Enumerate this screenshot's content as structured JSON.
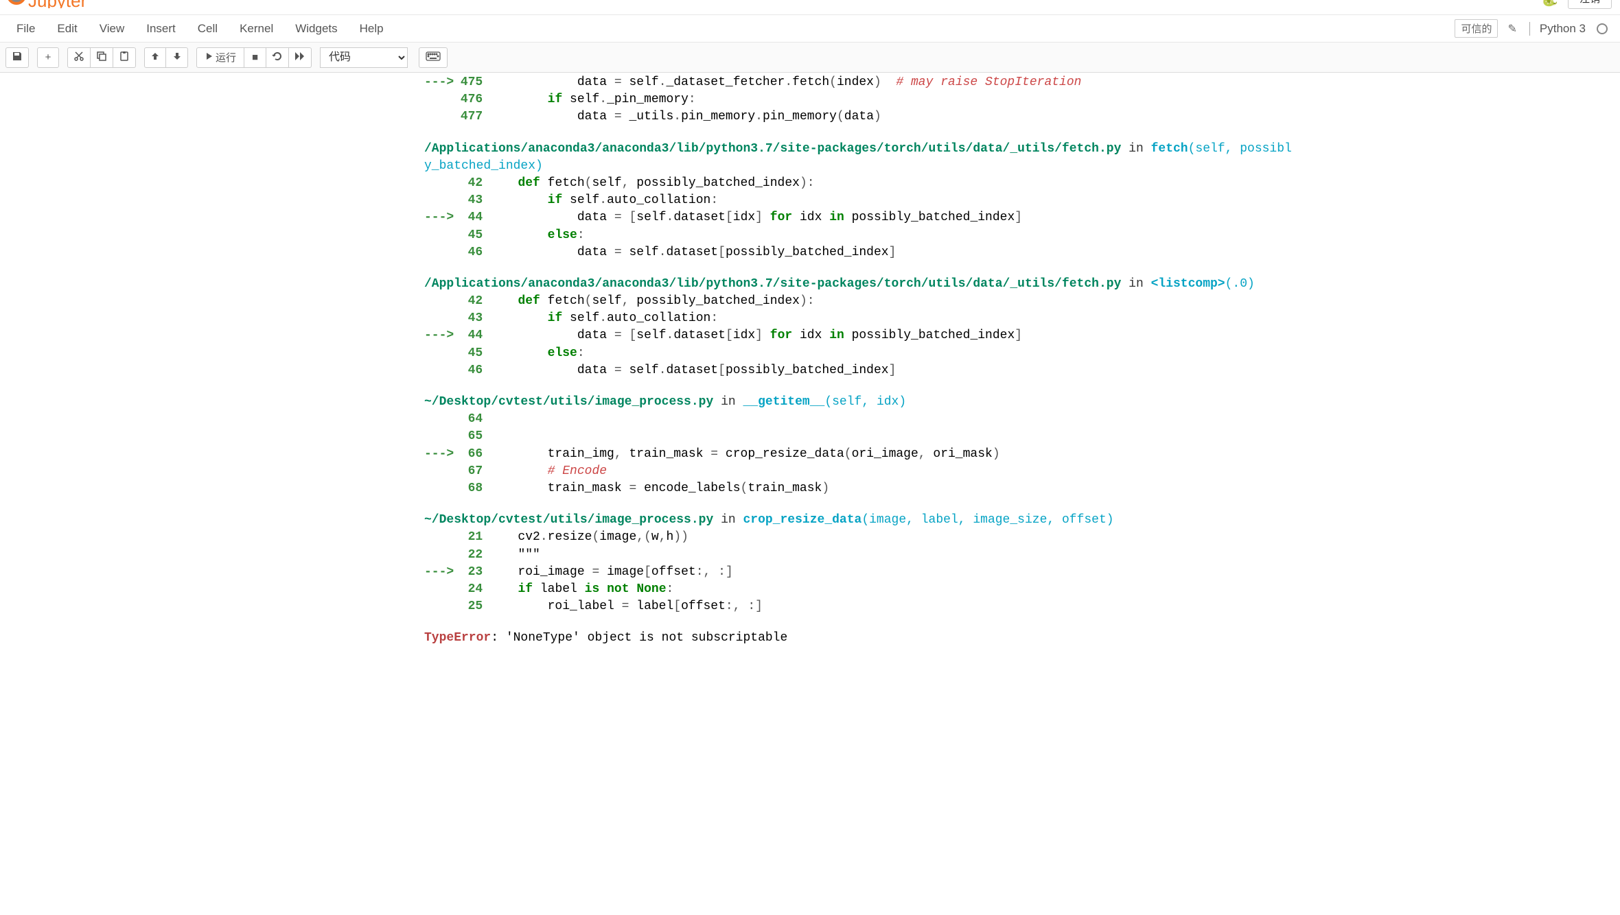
{
  "header": {
    "brand": "Jupyter",
    "logout": "注销",
    "trusted": "可信的",
    "kernel": "Python 3"
  },
  "menu": {
    "file": "File",
    "edit": "Edit",
    "view": "View",
    "insert": "Insert",
    "cell": "Cell",
    "kernel": "Kernel",
    "widgets": "Widgets",
    "help": "Help"
  },
  "toolbar": {
    "save": "💾",
    "add": "+",
    "cut": "✂",
    "copy": "⧉",
    "paste": "📋",
    "up": "↑",
    "down": "↓",
    "run": "运行",
    "stop": "■",
    "restart": "⟳",
    "ff": "⏩",
    "celltype": "代码",
    "cmd": "⌨"
  },
  "traceback": {
    "frame0": {
      "lines": [
        {
          "arrow": "--->",
          "no": "475",
          "code": "            data = self._dataset_fetcher.fetch(index)  ",
          "comment": "# may raise StopIteration"
        },
        {
          "arrow": "",
          "no": "476",
          "code": "        if self._pin_memory:",
          "kw_if": true
        },
        {
          "arrow": "",
          "no": "477",
          "code": "            data = _utils.pin_memory.pin_memory(data)"
        }
      ]
    },
    "frame1": {
      "path": "/Applications/anaconda3/anaconda3/lib/python3.7/site-packages/torch/utils/data/_utils/fetch.py",
      "in": " in ",
      "func": "fetch",
      "params": "(self, possibly_batched_index)",
      "lines": [
        {
          "arrow": "",
          "no": "42",
          "code": "    def fetch(self, possibly_batched_index):",
          "def": true
        },
        {
          "arrow": "",
          "no": "43",
          "code": "        if self.auto_collation:",
          "kw_if": true
        },
        {
          "arrow": "--->",
          "no": "44",
          "code": "            data = [self.dataset[idx] for idx in possibly_batched_index]",
          "forcomp": true
        },
        {
          "arrow": "",
          "no": "45",
          "code": "        else:",
          "else": true
        },
        {
          "arrow": "",
          "no": "46",
          "code": "            data = self.dataset[possibly_batched_index]"
        }
      ]
    },
    "frame2": {
      "path": "/Applications/anaconda3/anaconda3/lib/python3.7/site-packages/torch/utils/data/_utils/fetch.py",
      "in": " in ",
      "func": "<listcomp>",
      "params": "(.0)",
      "lines": [
        {
          "arrow": "",
          "no": "42",
          "code": "    def fetch(self, possibly_batched_index):",
          "def": true
        },
        {
          "arrow": "",
          "no": "43",
          "code": "        if self.auto_collation:",
          "kw_if": true
        },
        {
          "arrow": "--->",
          "no": "44",
          "code": "            data = [self.dataset[idx] for idx in possibly_batched_index]",
          "forcomp": true
        },
        {
          "arrow": "",
          "no": "45",
          "code": "        else:",
          "else": true
        },
        {
          "arrow": "",
          "no": "46",
          "code": "            data = self.dataset[possibly_batched_index]"
        }
      ]
    },
    "frame3": {
      "path": "~/Desktop/cvtest/utils/image_process.py",
      "in": " in ",
      "func": "__getitem__",
      "params": "(self, idx)",
      "lines": [
        {
          "arrow": "",
          "no": "64",
          "code": ""
        },
        {
          "arrow": "",
          "no": "65",
          "code": ""
        },
        {
          "arrow": "--->",
          "no": "66",
          "code": "        train_img, train_mask = crop_resize_data(ori_image, ori_mask)"
        },
        {
          "arrow": "",
          "no": "67",
          "code": "        # Encode",
          "iscomment": true
        },
        {
          "arrow": "",
          "no": "68",
          "code": "        train_mask = encode_labels(train_mask)"
        }
      ]
    },
    "frame4": {
      "path": "~/Desktop/cvtest/utils/image_process.py",
      "in": " in ",
      "func": "crop_resize_data",
      "params": "(image, label, image_size, offset)",
      "lines": [
        {
          "arrow": "",
          "no": "21",
          "code": "    cv2.resize(image,(w,h))"
        },
        {
          "arrow": "",
          "no": "22",
          "code": "    \"\"\"",
          "isstr": true
        },
        {
          "arrow": "--->",
          "no": "23",
          "code": "    roi_image = image[offset:, :]"
        },
        {
          "arrow": "",
          "no": "24",
          "code": "    if label is not None:",
          "kw_if2": true
        },
        {
          "arrow": "",
          "no": "25",
          "code": "        roi_label = label[offset:, :]"
        }
      ]
    },
    "error": {
      "type": "TypeError",
      "msg": ": 'NoneType' object is not subscriptable"
    }
  }
}
